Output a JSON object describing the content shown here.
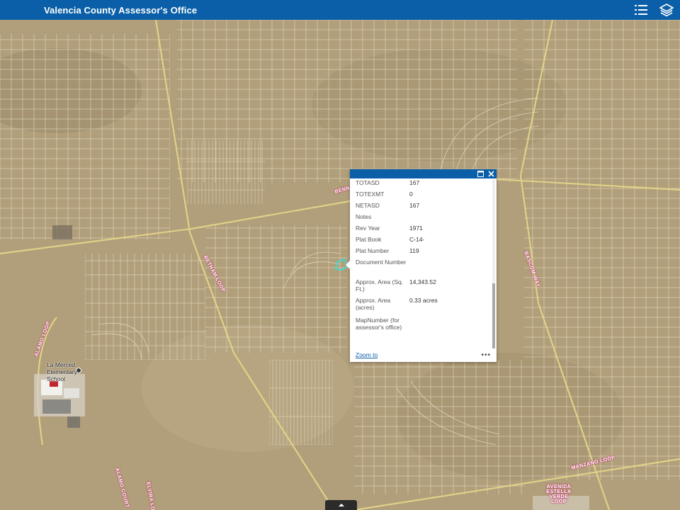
{
  "app": {
    "title": "Valencia County Assessor's Office"
  },
  "toolbar": {
    "legend_icon": "list-icon",
    "layers_icon": "layers-icon"
  },
  "map": {
    "road_labels": {
      "r1": "BENNY",
      "r2": "BETHAM LOOP",
      "r3": "BASCOM WAY",
      "r4": "ALAMO LOOP",
      "r5": "MANZANO LOOP",
      "r6": "ALAMO COURT",
      "r7": "ELVIRA LOOP",
      "r8": "AVENIDA ESTELLA VERDE LOOP"
    },
    "poi": {
      "name": "La Merced Elementary School"
    }
  },
  "popup": {
    "rows": [
      {
        "key": "TOTASD",
        "value": "167"
      },
      {
        "key": "TOTEXMT",
        "value": "0"
      },
      {
        "key": "NETASD",
        "value": "167"
      },
      {
        "key": "Notes",
        "value": ""
      },
      {
        "key": "Rev Year",
        "value": "1971"
      },
      {
        "key": "Plat Book",
        "value": "C-14-"
      },
      {
        "key": "Plat Number",
        "value": "119"
      },
      {
        "key": "Document Number",
        "value": ""
      },
      {
        "key": "Approx. Area (Sq. Ft.)",
        "value": "14,343.52"
      },
      {
        "key": "Approx. Area (acres)",
        "value": "0.33 acres"
      },
      {
        "key": "MapNumber (for assessor's office)",
        "value": ""
      }
    ],
    "zoom_label": "Zoom to",
    "more_label": "•••"
  }
}
